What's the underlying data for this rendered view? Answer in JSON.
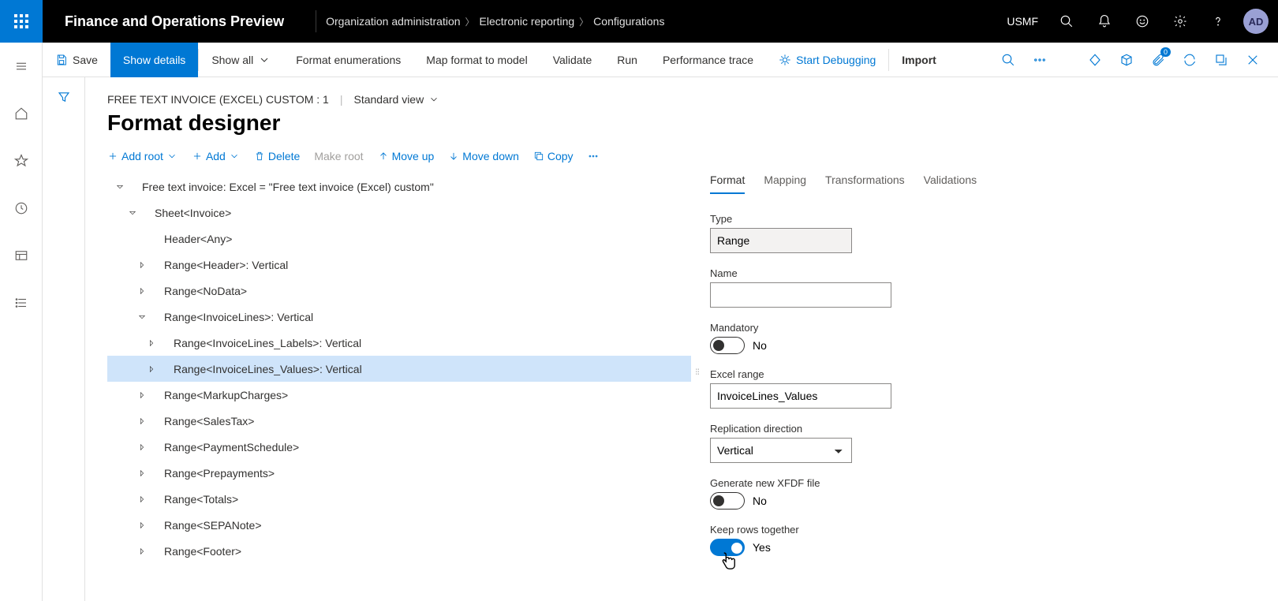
{
  "header": {
    "app_title": "Finance and Operations Preview",
    "breadcrumb": [
      "Organization administration",
      "Electronic reporting",
      "Configurations"
    ],
    "company": "USMF",
    "avatar": "AD"
  },
  "commandbar": {
    "save": "Save",
    "show_details": "Show details",
    "show_all": "Show all",
    "format_enum": "Format enumerations",
    "map_format": "Map format to model",
    "validate": "Validate",
    "run": "Run",
    "perf_trace": "Performance trace",
    "start_debug": "Start Debugging",
    "import": "Import",
    "badge": "0"
  },
  "page": {
    "crumb": "FREE TEXT INVOICE (EXCEL) CUSTOM : 1",
    "view": "Standard view",
    "title": "Format designer"
  },
  "toolbar": {
    "add_root": "Add root",
    "add": "Add",
    "delete": "Delete",
    "make_root": "Make root",
    "move_up": "Move up",
    "move_down": "Move down",
    "copy": "Copy"
  },
  "tree": {
    "items": [
      {
        "label": "Free text invoice: Excel = \"Free text invoice (Excel) custom\"",
        "expand": "open",
        "indent": 1
      },
      {
        "label": "Sheet<Invoice>",
        "expand": "open",
        "indent": 2
      },
      {
        "label": "Header<Any>",
        "expand": "none",
        "indent": 3
      },
      {
        "label": "Range<Header>: Vertical",
        "expand": "closed",
        "indent": 3
      },
      {
        "label": "Range<NoData>",
        "expand": "closed",
        "indent": 3
      },
      {
        "label": "Range<InvoiceLines>: Vertical",
        "expand": "open",
        "indent": 3
      },
      {
        "label": "Range<InvoiceLines_Labels>: Vertical",
        "expand": "closed",
        "indent": 4
      },
      {
        "label": "Range<InvoiceLines_Values>: Vertical",
        "expand": "closed",
        "indent": 4,
        "selected": true
      },
      {
        "label": "Range<MarkupCharges>",
        "expand": "closed",
        "indent": 3
      },
      {
        "label": "Range<SalesTax>",
        "expand": "closed",
        "indent": 3
      },
      {
        "label": "Range<PaymentSchedule>",
        "expand": "closed",
        "indent": 3
      },
      {
        "label": "Range<Prepayments>",
        "expand": "closed",
        "indent": 3
      },
      {
        "label": "Range<Totals>",
        "expand": "closed",
        "indent": 3
      },
      {
        "label": "Range<SEPANote>",
        "expand": "closed",
        "indent": 3
      },
      {
        "label": "Range<Footer>",
        "expand": "closed",
        "indent": 3
      }
    ]
  },
  "tabs": [
    "Format",
    "Mapping",
    "Transformations",
    "Validations"
  ],
  "props": {
    "type_label": "Type",
    "type_value": "Range",
    "name_label": "Name",
    "name_value": "",
    "mandatory_label": "Mandatory",
    "mandatory_value": "No",
    "excel_range_label": "Excel range",
    "excel_range_value": "InvoiceLines_Values",
    "replication_label": "Replication direction",
    "replication_value": "Vertical",
    "xfdf_label": "Generate new XFDF file",
    "xfdf_value": "No",
    "keep_rows_label": "Keep rows together",
    "keep_rows_value": "Yes"
  }
}
